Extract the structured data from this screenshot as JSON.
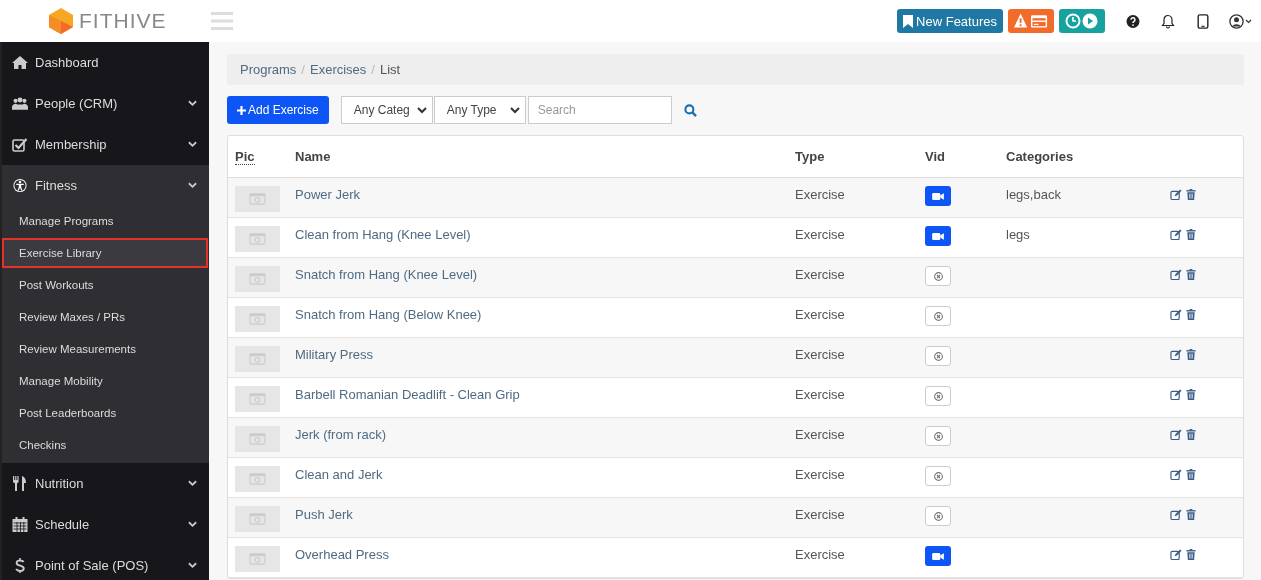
{
  "header": {
    "brand": "FITHIVE",
    "new_features": "New Features"
  },
  "sidebar": {
    "items": [
      {
        "label": "Dashboard"
      },
      {
        "label": "People (CRM)",
        "expanded": false
      },
      {
        "label": "Membership",
        "expanded": false
      },
      {
        "label": "Fitness",
        "expanded": true,
        "children": [
          {
            "label": "Manage Programs",
            "selected": false
          },
          {
            "label": "Exercise Library",
            "selected": true
          },
          {
            "label": "Post Workouts",
            "selected": false
          },
          {
            "label": "Review Maxes / PRs",
            "selected": false
          },
          {
            "label": "Review Measurements",
            "selected": false
          },
          {
            "label": "Manage Mobility",
            "selected": false
          },
          {
            "label": "Post Leaderboards",
            "selected": false
          },
          {
            "label": "Checkins",
            "selected": false
          }
        ]
      },
      {
        "label": "Nutrition",
        "expanded": false
      },
      {
        "label": "Schedule",
        "expanded": false
      },
      {
        "label": "Point of Sale (POS)",
        "expanded": false
      }
    ]
  },
  "breadcrumb": {
    "items": [
      "Programs",
      "Exercises",
      "List"
    ],
    "separators": [
      "/",
      "/"
    ]
  },
  "toolbar": {
    "add_button": "Add Exercise",
    "category_filter": "Any Categ",
    "type_filter": "Any Type",
    "search": {
      "placeholder": "Search"
    }
  },
  "table": {
    "columns": [
      "Pic",
      "Name",
      "Type",
      "Vid",
      "Categories"
    ],
    "rows": [
      {
        "name": "Power Jerk",
        "type": "Exercise",
        "video": true,
        "categories": "legs,back"
      },
      {
        "name": "Clean from Hang (Knee Level)",
        "type": "Exercise",
        "video": true,
        "categories": "legs"
      },
      {
        "name": "Snatch from Hang (Knee Level)",
        "type": "Exercise",
        "video": false
      },
      {
        "name": "Snatch from Hang (Below Knee)",
        "type": "Exercise",
        "video": false
      },
      {
        "name": "Military Press",
        "type": "Exercise",
        "video": false
      },
      {
        "name": "Barbell Romanian Deadlift - Clean Grip",
        "type": "Exercise",
        "video": false
      },
      {
        "name": "Jerk (from rack)",
        "type": "Exercise",
        "video": false
      },
      {
        "name": "Clean and Jerk",
        "type": "Exercise",
        "video": false
      },
      {
        "name": "Push Jerk",
        "type": "Exercise",
        "video": false
      },
      {
        "name": "Overhead Press",
        "type": "Exercise",
        "video": true
      }
    ]
  }
}
